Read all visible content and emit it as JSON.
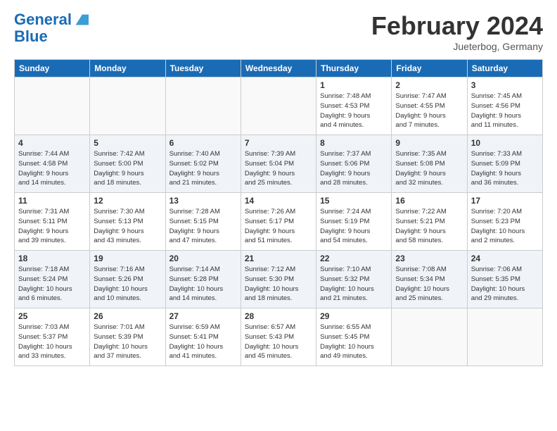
{
  "logo": {
    "line1": "General",
    "line2": "Blue"
  },
  "title": "February 2024",
  "location": "Jueterbog, Germany",
  "days_header": [
    "Sunday",
    "Monday",
    "Tuesday",
    "Wednesday",
    "Thursday",
    "Friday",
    "Saturday"
  ],
  "weeks": [
    [
      {
        "day": "",
        "info": ""
      },
      {
        "day": "",
        "info": ""
      },
      {
        "day": "",
        "info": ""
      },
      {
        "day": "",
        "info": ""
      },
      {
        "day": "1",
        "info": "Sunrise: 7:48 AM\nSunset: 4:53 PM\nDaylight: 9 hours\nand 4 minutes."
      },
      {
        "day": "2",
        "info": "Sunrise: 7:47 AM\nSunset: 4:55 PM\nDaylight: 9 hours\nand 7 minutes."
      },
      {
        "day": "3",
        "info": "Sunrise: 7:45 AM\nSunset: 4:56 PM\nDaylight: 9 hours\nand 11 minutes."
      }
    ],
    [
      {
        "day": "4",
        "info": "Sunrise: 7:44 AM\nSunset: 4:58 PM\nDaylight: 9 hours\nand 14 minutes."
      },
      {
        "day": "5",
        "info": "Sunrise: 7:42 AM\nSunset: 5:00 PM\nDaylight: 9 hours\nand 18 minutes."
      },
      {
        "day": "6",
        "info": "Sunrise: 7:40 AM\nSunset: 5:02 PM\nDaylight: 9 hours\nand 21 minutes."
      },
      {
        "day": "7",
        "info": "Sunrise: 7:39 AM\nSunset: 5:04 PM\nDaylight: 9 hours\nand 25 minutes."
      },
      {
        "day": "8",
        "info": "Sunrise: 7:37 AM\nSunset: 5:06 PM\nDaylight: 9 hours\nand 28 minutes."
      },
      {
        "day": "9",
        "info": "Sunrise: 7:35 AM\nSunset: 5:08 PM\nDaylight: 9 hours\nand 32 minutes."
      },
      {
        "day": "10",
        "info": "Sunrise: 7:33 AM\nSunset: 5:09 PM\nDaylight: 9 hours\nand 36 minutes."
      }
    ],
    [
      {
        "day": "11",
        "info": "Sunrise: 7:31 AM\nSunset: 5:11 PM\nDaylight: 9 hours\nand 39 minutes."
      },
      {
        "day": "12",
        "info": "Sunrise: 7:30 AM\nSunset: 5:13 PM\nDaylight: 9 hours\nand 43 minutes."
      },
      {
        "day": "13",
        "info": "Sunrise: 7:28 AM\nSunset: 5:15 PM\nDaylight: 9 hours\nand 47 minutes."
      },
      {
        "day": "14",
        "info": "Sunrise: 7:26 AM\nSunset: 5:17 PM\nDaylight: 9 hours\nand 51 minutes."
      },
      {
        "day": "15",
        "info": "Sunrise: 7:24 AM\nSunset: 5:19 PM\nDaylight: 9 hours\nand 54 minutes."
      },
      {
        "day": "16",
        "info": "Sunrise: 7:22 AM\nSunset: 5:21 PM\nDaylight: 9 hours\nand 58 minutes."
      },
      {
        "day": "17",
        "info": "Sunrise: 7:20 AM\nSunset: 5:23 PM\nDaylight: 10 hours\nand 2 minutes."
      }
    ],
    [
      {
        "day": "18",
        "info": "Sunrise: 7:18 AM\nSunset: 5:24 PM\nDaylight: 10 hours\nand 6 minutes."
      },
      {
        "day": "19",
        "info": "Sunrise: 7:16 AM\nSunset: 5:26 PM\nDaylight: 10 hours\nand 10 minutes."
      },
      {
        "day": "20",
        "info": "Sunrise: 7:14 AM\nSunset: 5:28 PM\nDaylight: 10 hours\nand 14 minutes."
      },
      {
        "day": "21",
        "info": "Sunrise: 7:12 AM\nSunset: 5:30 PM\nDaylight: 10 hours\nand 18 minutes."
      },
      {
        "day": "22",
        "info": "Sunrise: 7:10 AM\nSunset: 5:32 PM\nDaylight: 10 hours\nand 21 minutes."
      },
      {
        "day": "23",
        "info": "Sunrise: 7:08 AM\nSunset: 5:34 PM\nDaylight: 10 hours\nand 25 minutes."
      },
      {
        "day": "24",
        "info": "Sunrise: 7:06 AM\nSunset: 5:35 PM\nDaylight: 10 hours\nand 29 minutes."
      }
    ],
    [
      {
        "day": "25",
        "info": "Sunrise: 7:03 AM\nSunset: 5:37 PM\nDaylight: 10 hours\nand 33 minutes."
      },
      {
        "day": "26",
        "info": "Sunrise: 7:01 AM\nSunset: 5:39 PM\nDaylight: 10 hours\nand 37 minutes."
      },
      {
        "day": "27",
        "info": "Sunrise: 6:59 AM\nSunset: 5:41 PM\nDaylight: 10 hours\nand 41 minutes."
      },
      {
        "day": "28",
        "info": "Sunrise: 6:57 AM\nSunset: 5:43 PM\nDaylight: 10 hours\nand 45 minutes."
      },
      {
        "day": "29",
        "info": "Sunrise: 6:55 AM\nSunset: 5:45 PM\nDaylight: 10 hours\nand 49 minutes."
      },
      {
        "day": "",
        "info": ""
      },
      {
        "day": "",
        "info": ""
      }
    ]
  ]
}
